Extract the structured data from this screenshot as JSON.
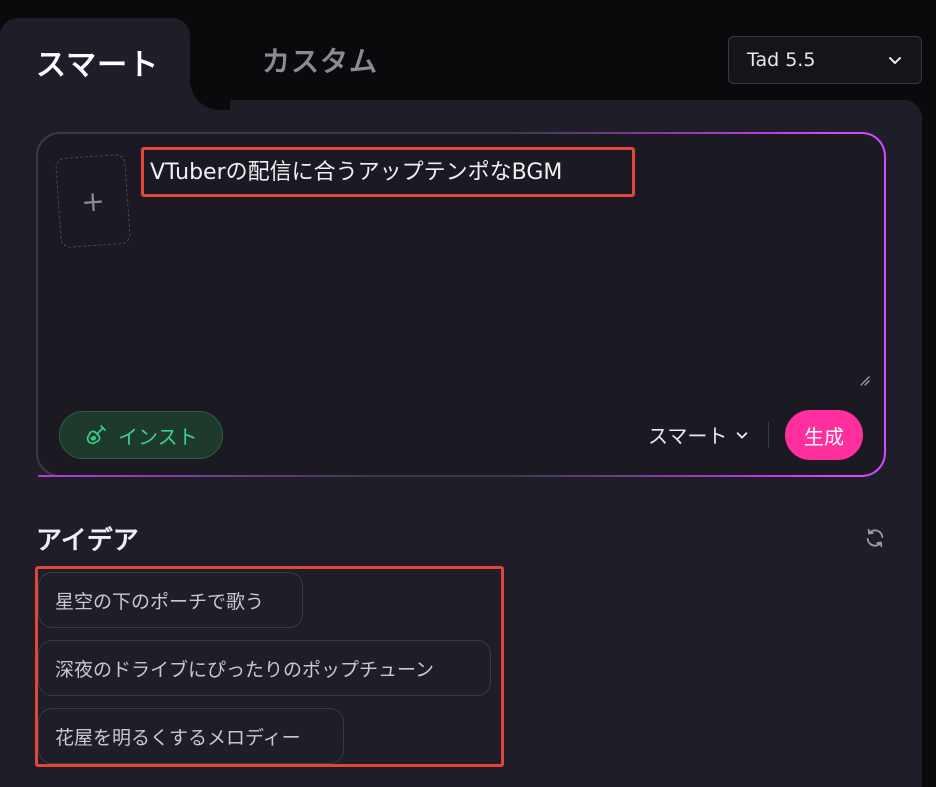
{
  "tabs": {
    "smart_label": "スマート",
    "custom_label": "カスタム"
  },
  "model_select": {
    "value": "Tad 5.5"
  },
  "prompt": {
    "upload_symbol": "+",
    "text": "VTuberの配信に合うアップテンポなBGM"
  },
  "toolbar": {
    "inst_label": "インスト",
    "mode_label": "スマート",
    "generate_label": "生成"
  },
  "ideas": {
    "title": "アイデア",
    "items": [
      "星空の下のポーチで歌う",
      "深夜のドライブにぴったりのポップチューン",
      "花屋を明るくするメロディー"
    ]
  },
  "colors": {
    "accent_pink": "#ff2fa0",
    "inst_green": "#3ed18a",
    "highlight_red": "#e0463c",
    "glow_purple": "#b93ce0"
  },
  "icons": [
    "chevron-down-icon",
    "plus-icon",
    "guitar-icon",
    "refresh-icon",
    "resize-handle-icon"
  ]
}
